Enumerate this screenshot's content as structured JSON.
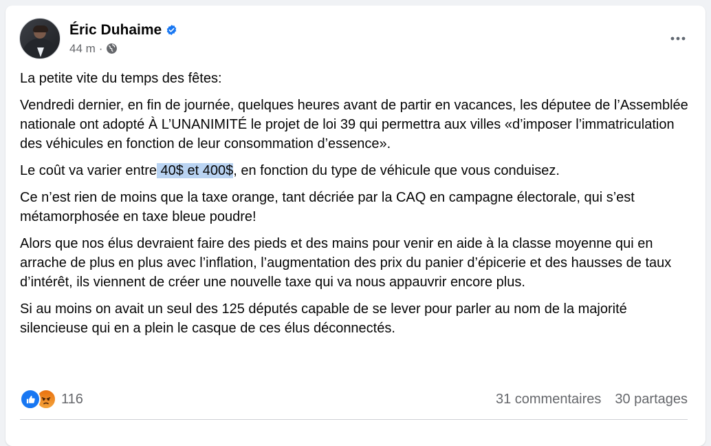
{
  "post": {
    "author": "Éric Duhaime",
    "time": "44 m",
    "separator": "·",
    "icons": {
      "verified": "verified-badge-icon",
      "privacy": "globe-icon",
      "menu": "more-horizontal-icon"
    },
    "paragraphs": {
      "p1": "La petite vite du temps des fêtes:",
      "p2": "Vendredi dernier, en fin de journée, quelques heures avant de partir en vacances, les députee de l’Assemblée nationale ont adopté À L’UNANIMITÉ le projet de loi 39 qui permettra aux villes «d’imposer l’immatriculation des véhicules en fonction de leur consommation d’essence».",
      "p3_before": "Le coût va varier entre",
      "p3_highlight": " 40$ et 400$",
      "p3_after": ", en fonction du type de véhicule que vous conduisez.",
      "p4": "Ce n’est rien de moins que la taxe orange, tant décriée par la CAQ en campagne électorale, qui s’est métamorphosée en taxe bleue poudre!",
      "p5": "Alors que nos élus devraient faire des pieds et des mains pour venir en aide à la classe moyenne qui en arrache de plus en plus avec l’inflation, l’augmentation des prix du panier d’épicerie et des hausses de taux d’intérêt, ils viennent de créer une nouvelle taxe qui va nous appauvrir encore plus.",
      "p6": "Si au moins on avait un seul des 125 députés capable de se lever pour parler au nom de la majorité silencieuse qui en a plein le casque de ces élus déconnectés."
    }
  },
  "footer": {
    "reaction_count": "116",
    "reaction_icons": [
      "like-icon",
      "angry-icon"
    ],
    "comments": "31 commentaires",
    "shares": "30 partages"
  },
  "colors": {
    "accent": "#1877f2",
    "highlight": "#b9d3f2",
    "muted_text": "#65676b"
  }
}
